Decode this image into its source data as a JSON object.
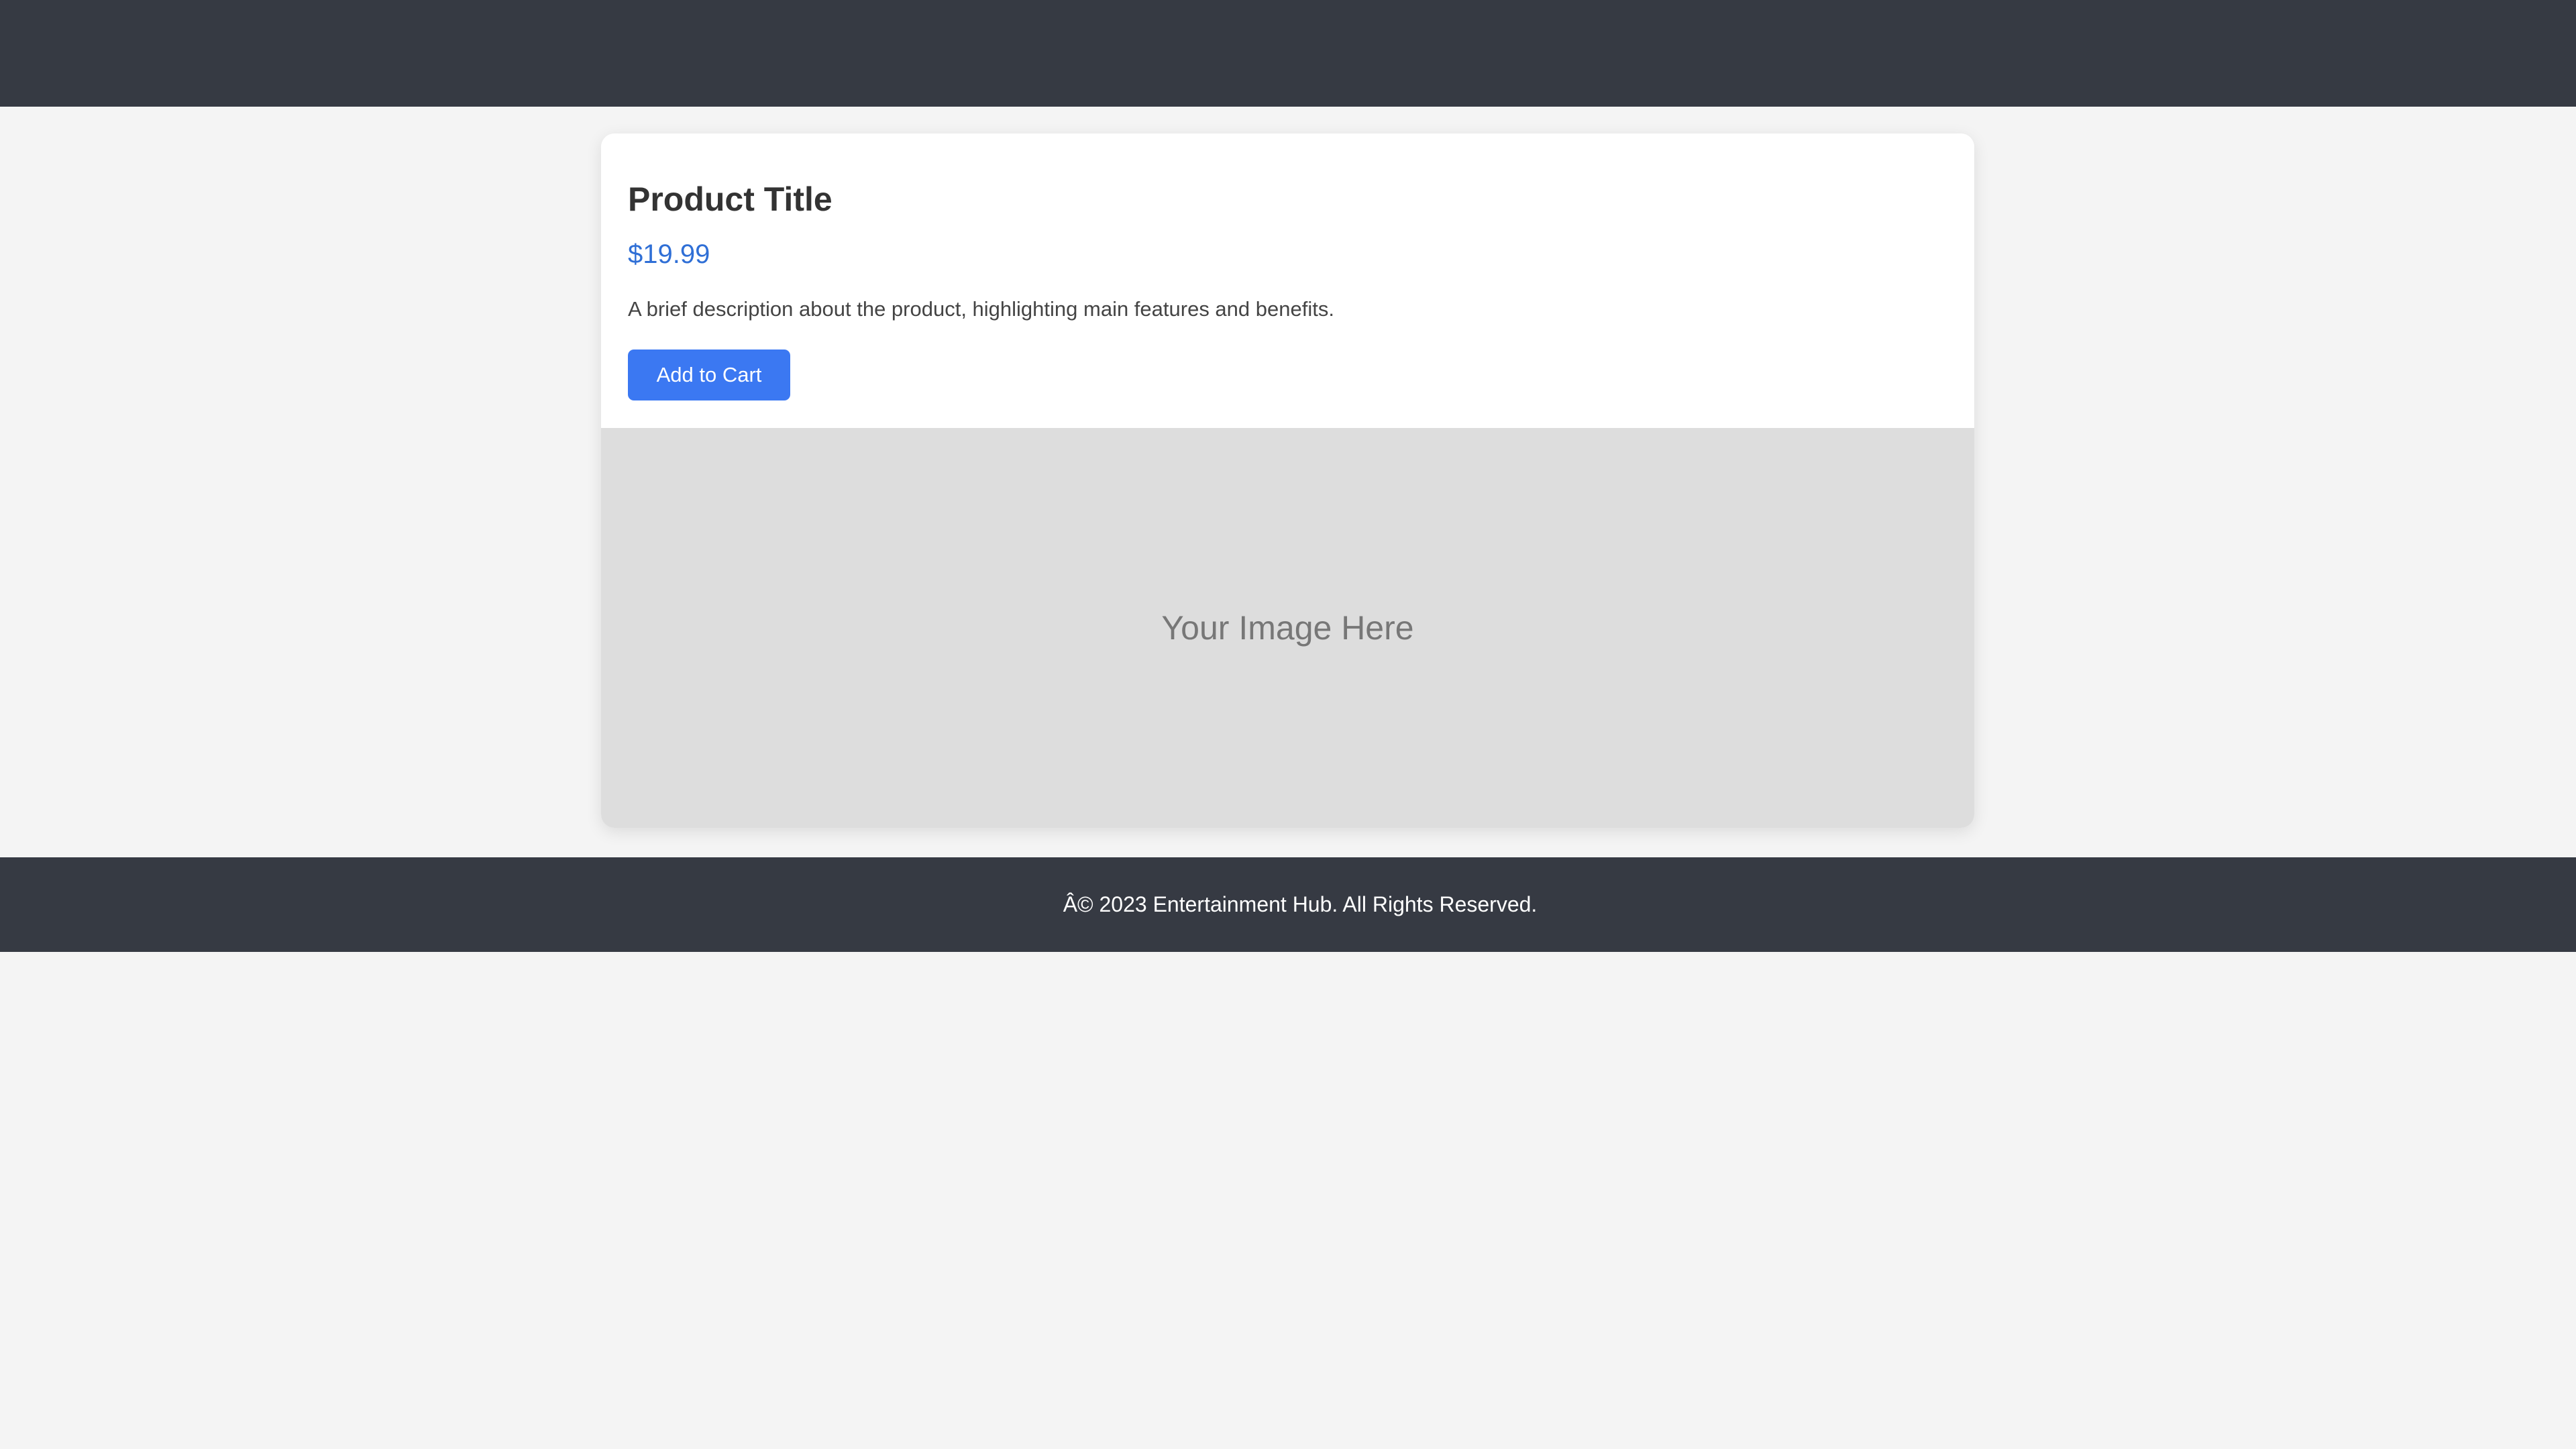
{
  "header": {
    "background_color": "#363a43"
  },
  "product": {
    "title": "Product Title",
    "price": "$19.99",
    "description": "A brief description about the product, highlighting main features and benefits.",
    "add_to_cart_label": "Add to Cart",
    "price_color": "#2f6fd6",
    "button_color": "#3b78f2"
  },
  "image_placeholder": {
    "text": "Your Image Here",
    "background_color": "#dddddd"
  },
  "footer": {
    "text": "Â© 2023 Entertainment Hub. All Rights Reserved.",
    "background_color": "#363a43"
  }
}
